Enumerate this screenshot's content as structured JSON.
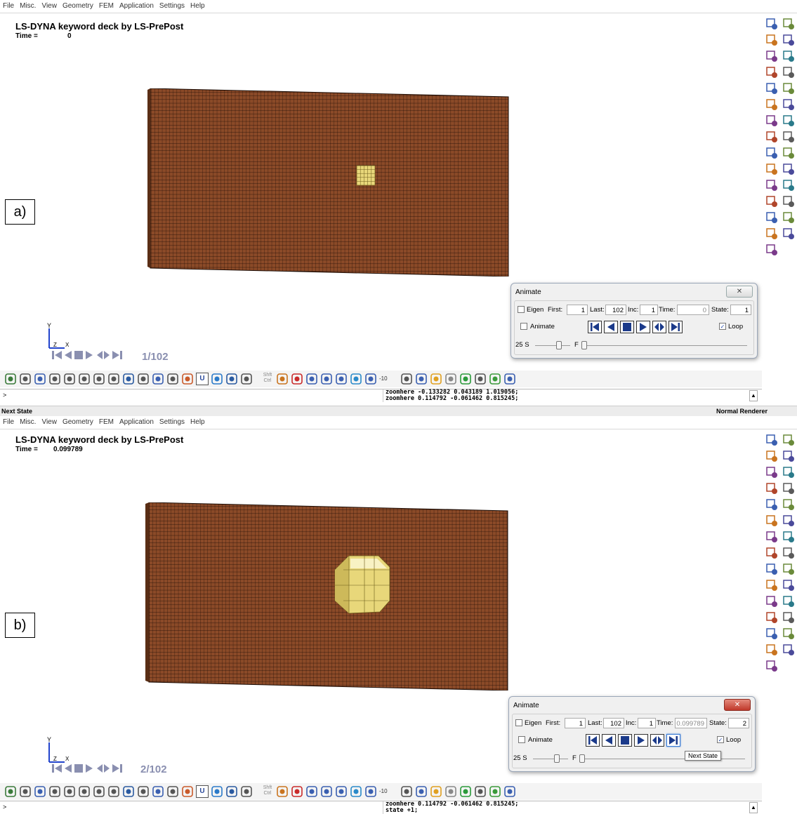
{
  "menu": [
    "File",
    "Misc.",
    "View",
    "Geometry",
    "FEM",
    "Application",
    "Settings",
    "Help"
  ],
  "colors": {
    "mesh": "#8b4a28",
    "mesh_line": "#1a0a03",
    "projectile": "#e8d77a",
    "accent": "#2a50b0"
  },
  "panels": [
    {
      "letter": "a)",
      "title": "LS-DYNA keyword deck by LS-PrePost",
      "time_label": "Time =",
      "time_value": "0",
      "state_counter": "1/102",
      "dialog": {
        "title": "Animate",
        "close": "✕",
        "eigen": "Eigen",
        "first_label": "First:",
        "first": "1",
        "last_label": "Last:",
        "last": "102",
        "inc_label": "Inc:",
        "inc": "1",
        "time_label": "Time:",
        "time": "0",
        "state_label": "State:",
        "state": "1",
        "animate": "Animate",
        "loop": "Loop",
        "speed_s": "25 S",
        "speed_f": "F"
      },
      "cmd_prompt": ">",
      "cmd_msgs": [
        "zoomhere -0.133282 0.043189 1.019056;",
        "zoomhere 0.114792 -0.061462 0.815245;"
      ],
      "status_left": "Next State",
      "status_right": "Normal Renderer"
    },
    {
      "letter": "b)",
      "title": "LS-DYNA keyword deck by LS-PrePost",
      "time_label": "Time =",
      "time_value": "0.099789",
      "state_counter": "2/102",
      "dialog": {
        "title": "Animate",
        "close": "✕",
        "eigen": "Eigen",
        "first_label": "First:",
        "first": "1",
        "last_label": "Last:",
        "last": "102",
        "inc_label": "Inc:",
        "inc": "1",
        "time_label": "Time:",
        "time": "0.099789",
        "state_label": "State:",
        "state": "2",
        "animate": "Animate",
        "loop": "Loop",
        "speed_s": "25 S",
        "speed_f": "F",
        "tooltip": "Next State"
      },
      "cmd_prompt": ">",
      "cmd_msgs": [
        "zoomhere 0.114792 -0.061462 0.815245;",
        "state +1;"
      ]
    }
  ],
  "toolbar": {
    "shft": "Shft",
    "ctrl": "Ctrl",
    "minus10": "-10",
    "u": "U"
  },
  "right_toolbar_icons": [
    "node-icon",
    "part-icon",
    "zoom-node-icon",
    "curve-icon",
    "mesh-small-icon",
    "surface-icon",
    "element-gear-icon",
    "sphere-icon",
    "grid-icon",
    "flag-icon",
    "element-tools-icon",
    "mesh-tri-icon",
    "transform-icon",
    "assembly-icon",
    "element-box-icon",
    "element-grid-icon",
    "points-icon",
    "card-icon",
    "pen-icon",
    "ms-icon",
    "edit-element-icon",
    "check-icon",
    "ruler-icon",
    "list-icon",
    "mesh-select-icon",
    "spring-icon",
    "settings-icon",
    "color-grid-icon",
    "material-icon"
  ]
}
